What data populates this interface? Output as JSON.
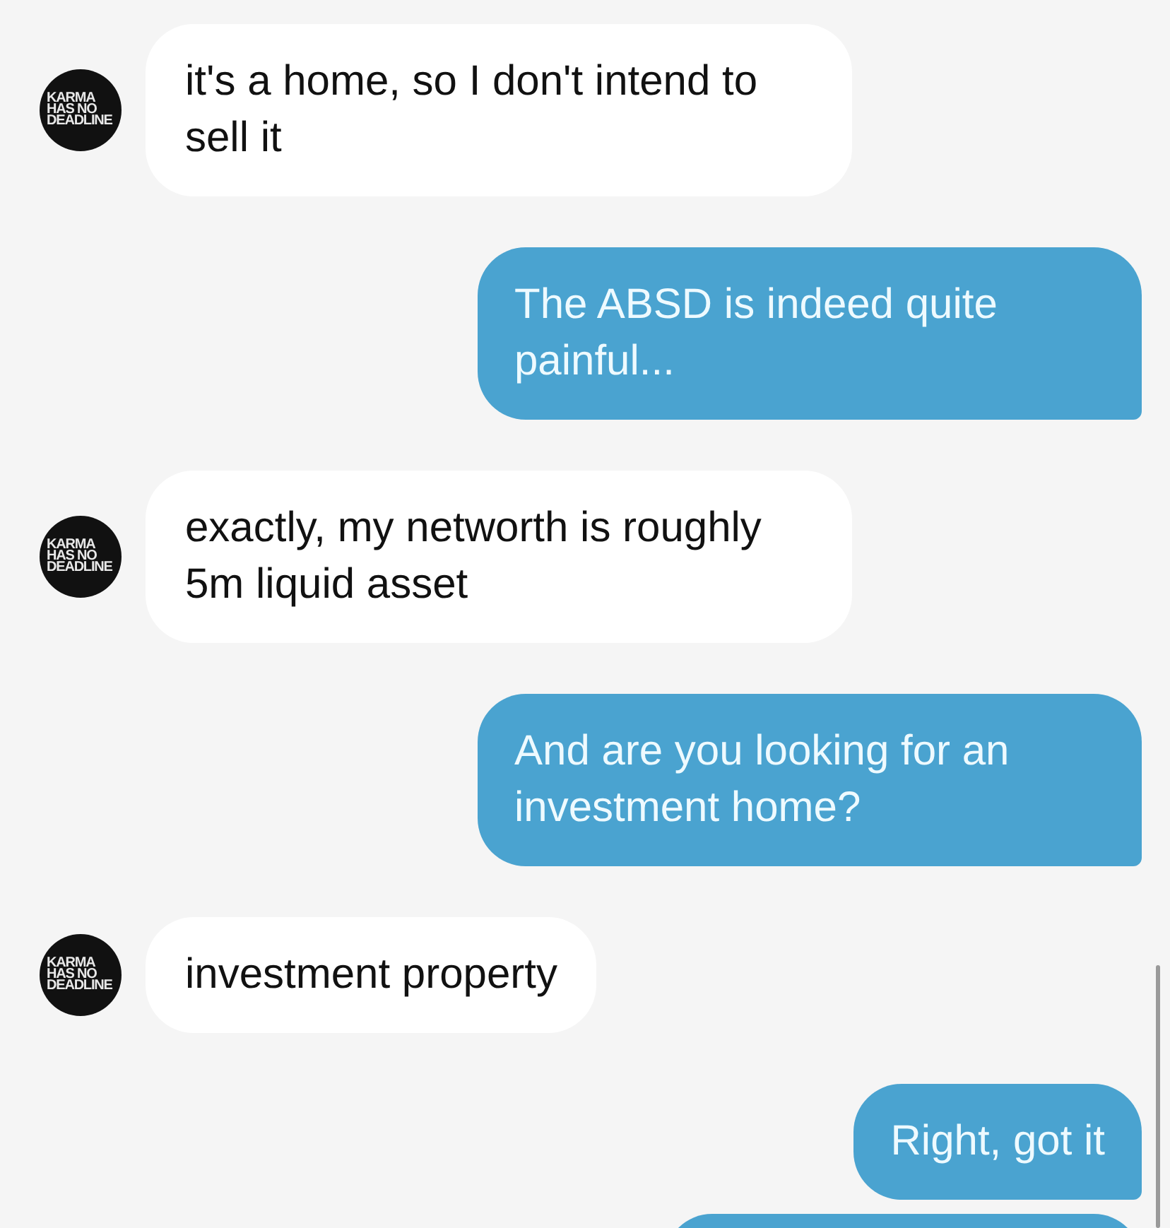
{
  "messages": [
    {
      "kind": "incoming",
      "text": "it's a home, so I don't intend to sell it",
      "avatar": [
        "KARMA",
        "HAS NO",
        "DEADLINE"
      ]
    },
    {
      "kind": "outgoing",
      "text": "The ABSD is indeed quite painful..."
    },
    {
      "kind": "incoming",
      "text": "exactly, my networth is roughly 5m liquid asset",
      "avatar": [
        "KARMA",
        "HAS NO",
        "DEADLINE"
      ]
    },
    {
      "kind": "outgoing",
      "text": "And are you looking for an investment home?"
    },
    {
      "kind": "incoming",
      "text": "investment property",
      "avatar": [
        "KARMA",
        "HAS NO",
        "DEADLINE"
      ]
    },
    {
      "kind": "outgoing",
      "text": "Right, got it"
    },
    {
      "kind": "outgoing_cut"
    }
  ]
}
